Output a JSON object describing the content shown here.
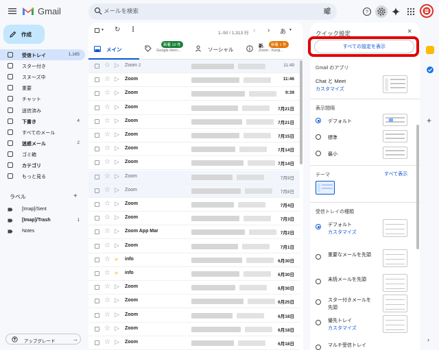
{
  "app": {
    "name": "Gmail"
  },
  "search": {
    "placeholder": "メールを検索"
  },
  "sidebar": {
    "compose": "作成",
    "items": [
      {
        "label": "受信トレイ",
        "count": "1,165",
        "icon": "inbox-icon",
        "bold": true,
        "selected": true
      },
      {
        "label": "スター付き",
        "count": "",
        "icon": "star-icon"
      },
      {
        "label": "スヌーズ中",
        "count": "",
        "icon": "clock-icon"
      },
      {
        "label": "重要",
        "count": "",
        "icon": "label-important-icon"
      },
      {
        "label": "チャット",
        "count": "",
        "icon": "chat-icon"
      },
      {
        "label": "送信済み",
        "count": "",
        "icon": "send-icon"
      },
      {
        "label": "下書き",
        "count": "4",
        "icon": "draft-icon",
        "bold": true
      },
      {
        "label": "すべてのメール",
        "count": "",
        "icon": "all-mail-icon"
      },
      {
        "label": "迷惑メール",
        "count": "2",
        "icon": "spam-icon",
        "bold": true
      },
      {
        "label": "ゴミ箱",
        "count": "",
        "icon": "trash-icon"
      },
      {
        "label": "カテゴリ",
        "count": "",
        "icon": "category-icon",
        "bold": true
      },
      {
        "label": "もっと見る",
        "count": "",
        "icon": "chevron-down-icon"
      }
    ],
    "labels_header": "ラベル",
    "labels": [
      {
        "label": "[Imap]/Sent",
        "count": "",
        "bold": false
      },
      {
        "label": "[Imap]/Trash",
        "count": "1",
        "bold": true
      },
      {
        "label": "Notes",
        "count": "",
        "bold": false
      }
    ],
    "upgrade": "アップグレード"
  },
  "toolbar": {
    "range": "1–50 / 1,313 行",
    "ime": "あ"
  },
  "tabs": [
    {
      "label": "メイン",
      "badge": "",
      "sub": ""
    },
    {
      "label": "",
      "badge": "新着 10 件",
      "sub": "Google Hom..."
    },
    {
      "label": "ソーシャル",
      "badge": "",
      "sub": ""
    },
    {
      "label": "新.",
      "badge": "新着 1 件",
      "sub": "Zoom - Kenji..."
    }
  ],
  "emails": [
    {
      "sender": "Zoom",
      "count": "2",
      "date": "11:49",
      "read": true,
      "imp": false
    },
    {
      "sender": "Zoom",
      "count": "",
      "date": "11:46",
      "read": false,
      "imp": false
    },
    {
      "sender": "Zoom",
      "count": "",
      "date": "9:39",
      "read": false,
      "imp": false
    },
    {
      "sender": "Zoom",
      "count": "",
      "date": "7月21日",
      "read": false,
      "imp": false
    },
    {
      "sender": "Zoom",
      "count": "",
      "date": "7月21日",
      "read": false,
      "imp": false
    },
    {
      "sender": "Zoom",
      "count": "",
      "date": "7月15日",
      "read": false,
      "imp": false
    },
    {
      "sender": "Zoom",
      "count": "",
      "date": "7月14日",
      "read": false,
      "imp": false
    },
    {
      "sender": "Zoom",
      "count": "",
      "date": "7月14日",
      "read": false,
      "imp": false
    },
    {
      "sender": "Zoom",
      "count": "",
      "date": "7月9日",
      "read": true,
      "imp": false
    },
    {
      "sender": "Zoom",
      "count": "",
      "date": "7月8日",
      "read": true,
      "imp": false
    },
    {
      "sender": "Zoom",
      "count": "",
      "date": "7月4日",
      "read": false,
      "imp": false
    },
    {
      "sender": "Zoom",
      "count": "",
      "date": "7月3日",
      "read": false,
      "imp": false
    },
    {
      "sender": "Zoom App Mar",
      "count": "",
      "date": "7月2日",
      "read": false,
      "imp": false
    },
    {
      "sender": "Zoom",
      "count": "",
      "date": "7月1日",
      "read": false,
      "imp": false
    },
    {
      "sender": "info",
      "count": "",
      "date": "6月30日",
      "read": false,
      "imp": true
    },
    {
      "sender": "info",
      "count": "",
      "date": "6月30日",
      "read": false,
      "imp": true
    },
    {
      "sender": "Zoom",
      "count": "",
      "date": "6月30日",
      "read": false,
      "imp": false
    },
    {
      "sender": "Zoom",
      "count": "",
      "date": "6月25日",
      "read": false,
      "imp": false
    },
    {
      "sender": "Zoom",
      "count": "",
      "date": "6月18日",
      "read": false,
      "imp": false
    },
    {
      "sender": "Zoom",
      "count": "",
      "date": "6月18日",
      "read": false,
      "imp": false
    },
    {
      "sender": "Zoom",
      "count": "",
      "date": "6月18日",
      "read": false,
      "imp": false
    },
    {
      "sender": "Zoom",
      "count": "",
      "date": "6月18日",
      "read": false,
      "imp": false
    }
  ],
  "quick_settings": {
    "title": "クイック設定",
    "all_settings": "すべての設定を表示",
    "apps_header": "Gmail のアプリ",
    "apps_value": "Chat と Meet",
    "customize": "カスタマイズ",
    "density_header": "表示間隔",
    "density": [
      {
        "label": "デフォルト",
        "on": true
      },
      {
        "label": "標準",
        "on": false
      },
      {
        "label": "最小",
        "on": false
      }
    ],
    "theme_header": "テーマ",
    "theme_link": "すべて表示",
    "inbox_header": "受信トレイの種類",
    "inbox_types": [
      {
        "label": "デフォルト",
        "sub": "カスタマイズ",
        "on": true
      },
      {
        "label": "重要なメールを先頭",
        "sub": "",
        "on": false
      },
      {
        "label": "未読メールを先頭",
        "sub": "",
        "on": false
      },
      {
        "label": "スター付きメールを",
        "label2": "先頭",
        "sub": "",
        "on": false
      },
      {
        "label": "優先トレイ",
        "sub": "カスタマイズ",
        "on": false
      },
      {
        "label": "マルチ受信トレイ",
        "sub": "",
        "on": false
      }
    ]
  },
  "colors": {
    "accent": "#0b57d0",
    "selected_nav": "#d3e3fd",
    "compose": "#c2e7ff",
    "highlight": "#e00000"
  }
}
